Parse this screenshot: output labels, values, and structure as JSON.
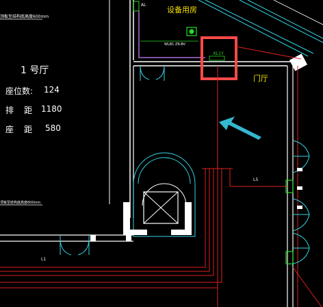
{
  "app": "CAD floor plan",
  "labels": {
    "equipment_room": "设备用房",
    "lobby": "门厅",
    "hall_title": "1 号厅",
    "seats_label": "座位数:",
    "seats_value": "124",
    "row_spacing_label": "排    距",
    "row_spacing_value": "1180",
    "seat_spacing_label": "座    距",
    "seat_spacing_value": "580",
    "top_dim_note": "顶板至结构底高度600mm",
    "bottom_dim_note": "顶板至结构底高度600mm",
    "panel_tag": "AL",
    "small_tag_1": "WLB1  ZR-BV",
    "small_tag_2": "KL1Y",
    "small_tag_3": "L5",
    "small_tag_4": "L1"
  },
  "colors": {
    "background": "#000000",
    "wall": "#ffffff",
    "cyan": "#33d6e6",
    "red": "#e02020",
    "highlight_box": "#ff4a4a",
    "arrow": "#34b8d0",
    "green": "#22dd22",
    "yellow_text": "#f5e100",
    "magenta": "#b06ad8"
  }
}
